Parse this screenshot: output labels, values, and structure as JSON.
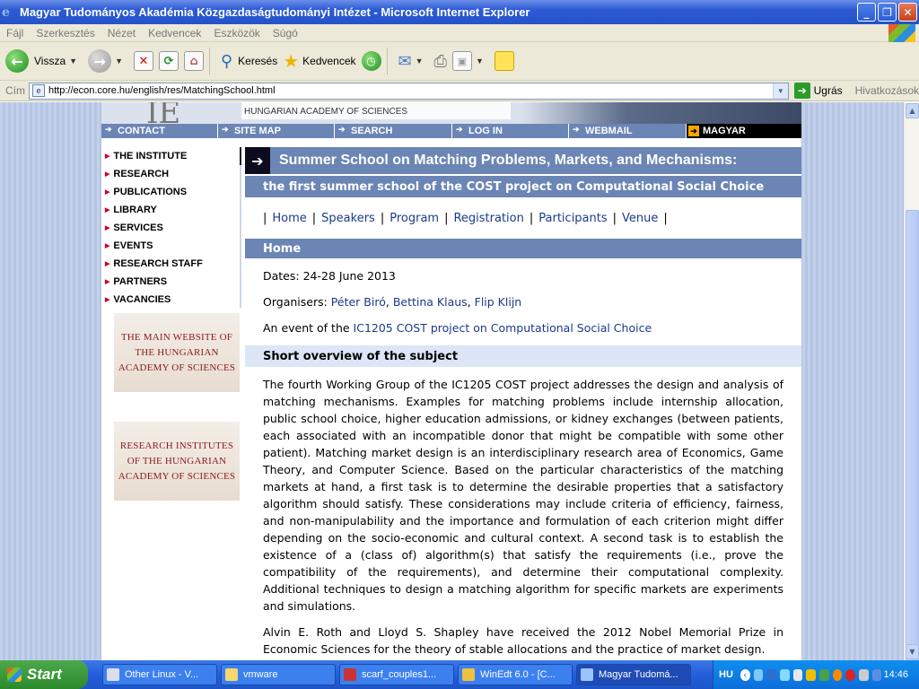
{
  "window": {
    "title": "Magyar Tudományos Akadémia Közgazdaságtudományi Intézet - Microsoft Internet Explorer"
  },
  "menu": [
    "Fájl",
    "Szerkesztés",
    "Nézet",
    "Kedvencek",
    "Eszközök",
    "Súgó"
  ],
  "toolbar": {
    "back": "Vissza",
    "search": "Keresés",
    "favorites": "Kedvencek"
  },
  "address": {
    "label": "Cím",
    "url": "http://econ.core.hu/english/res/MatchingSchool.html",
    "go": "Ugrás",
    "links": "Hivatkozások"
  },
  "site": {
    "logo_letters": "IE",
    "academy": "HUNGARIAN ACADEMY OF SCIENCES",
    "topnav": [
      "CONTACT",
      "SITE MAP",
      "SEARCH",
      "LOG IN",
      "WEBMAIL",
      "MAGYAR"
    ],
    "leftnav": [
      "THE INSTITUTE",
      "RESEARCH",
      "PUBLICATIONS",
      "LIBRARY",
      "SERVICES",
      "EVENTS",
      "RESEARCH STAFF",
      "PARTNERS",
      "VACANCIES"
    ],
    "banner1": [
      "THE MAIN WEBSITE OF",
      "THE HUNGARIAN",
      "ACADEMY OF SCIENCES"
    ],
    "banner2": [
      "RESEARCH INSTITUTES",
      "OF THE HUNGARIAN",
      "ACADEMY OF SCIENCES"
    ]
  },
  "content": {
    "title": "Summer School on Matching Problems, Markets, and Mechanisms:",
    "subtitle": "the first summer school of the COST project on Computational Social Choice",
    "links": [
      "Home",
      "Speakers",
      "Program",
      "Registration",
      "Participants",
      "Venue"
    ],
    "section_home": "Home",
    "dates": "Dates: 24-28 June 2013",
    "organisers_label": "Organisers: ",
    "organisers": [
      "Péter Biró",
      "Bettina Klaus",
      "Flip Klijn"
    ],
    "event_prefix": "An event of the ",
    "event_link": "IC1205 COST project on Computational Social Choice",
    "overview_title": "Short overview of the subject",
    "overview_text": "The fourth Working Group of the IC1205 COST project addresses the design and analysis of matching mechanisms. Examples for matching problems include internship allocation, public school choice, higher education admissions, or kidney exchanges (between patients, each associated with an incompatible donor that might be compatible with some other patient). Matching market design is an interdisciplinary research area of Economics, Game Theory, and Computer Science. Based on the particular characteristics of the matching markets at hand, a first task is to determine the desirable properties that a satisfactory algorithm should satisfy. These considerations may include criteria of efficiency, fairness, and non-manipulability and the importance and formulation of each criterion might differ depending on the socio-economic and  cultural context. A second task is to establish the existence of a (class of) algorithm(s) that satisfy the requirements (i.e., prove the compatibility of the requirements), and determine their computational complexity. Additional techniques to design a matching algorithm for specific markets are experiments and simulations.",
    "nobel_text": "Alvin E. Roth and Lloyd S. Shapley have received the 2012 Nobel Memorial Prize in Economic Sciences for the theory of stable allocations and the practice of market design."
  },
  "taskbar": {
    "start": "Start",
    "tasks": [
      "Other Linux - V...",
      "vmware",
      "scarf_couples1...",
      "WinEdt 6.0 - [C...",
      "Magyar Tudomá..."
    ],
    "lang": "HU",
    "clock": "14:46"
  }
}
